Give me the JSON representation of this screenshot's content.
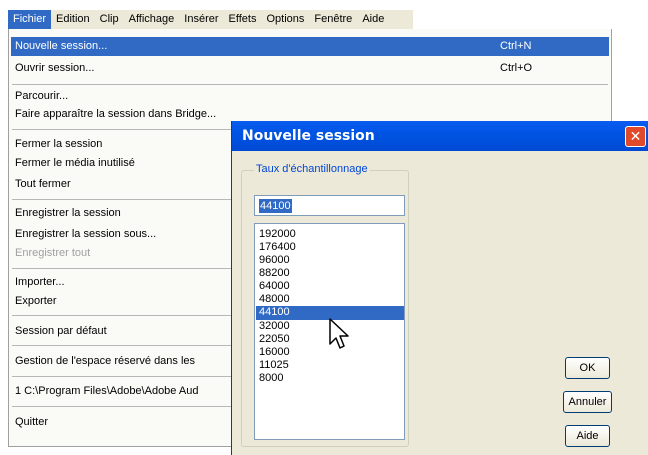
{
  "menubar": {
    "items": [
      "Fichier",
      "Edition",
      "Clip",
      "Affichage",
      "Insérer",
      "Effets",
      "Options",
      "Fenêtre",
      "Aide"
    ]
  },
  "menu": {
    "new_session": "Nouvelle session...",
    "new_session_shortcut": "Ctrl+N",
    "open_session": "Ouvrir session...",
    "open_session_shortcut": "Ctrl+O",
    "browse": "Parcourir...",
    "show_in_bridge": "Faire apparaître la session dans Bridge...",
    "close_session": "Fermer la session",
    "close_unused_media": "Fermer le média inutilisé",
    "close_all": "Tout fermer",
    "save_session": "Enregistrer la session",
    "save_session_as": "Enregistrer la session sous...",
    "save_all": "Enregistrer tout",
    "import": "Importer...",
    "export": "Exporter",
    "default_session": "Session par défaut",
    "reserved_space": "Gestion de l'espace réservé dans les",
    "recent_file": "1 C:\\Program Files\\Adobe\\Adobe Aud",
    "quit": "Quitter"
  },
  "dialog": {
    "title": "Nouvelle session",
    "close_glyph": "✕",
    "group_label": "Taux d'échantillonnage",
    "rate_value": "44100",
    "rates": [
      "192000",
      "176400",
      "96000",
      "88200",
      "64000",
      "48000",
      "44100",
      "32000",
      "22050",
      "16000",
      "11025",
      "8000"
    ],
    "selected_rate": "44100",
    "ok_label": "OK",
    "cancel_label": "Annuler",
    "help_label": "Aide"
  },
  "colors": {
    "highlight": "#316ac5",
    "titlebar": "#0054e3",
    "dialog_bg": "#ece9d8"
  }
}
